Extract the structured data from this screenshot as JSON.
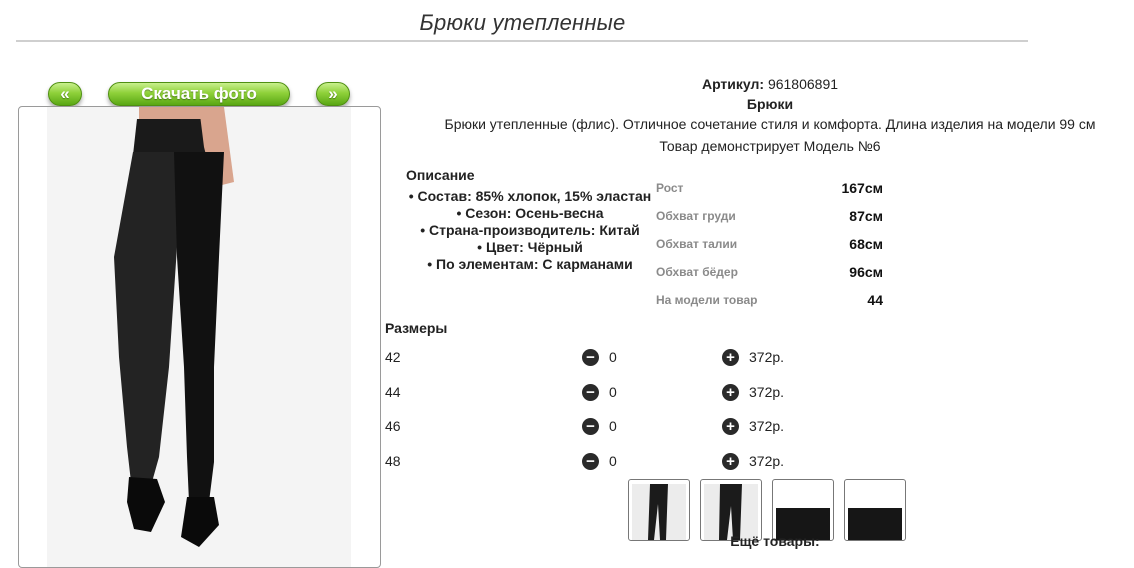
{
  "header": {
    "title": "Брюки утепленные"
  },
  "gallery": {
    "prev_label": "«",
    "download_label": "Скачать фото",
    "next_label": "»"
  },
  "product": {
    "article_label": "Артикул:",
    "article_value": "961806891",
    "type": "Брюки",
    "description": "Брюки утепленные (флис). Отличное сочетание стиля и комфорта. Длина изделия на модели 99 см",
    "model_note": "Товар демонстрирует Модель №6"
  },
  "description_block": {
    "title": "Описание",
    "items": [
      "• Состав: 85% хлопок, 15% эластан",
      "• Сезон: Осень-весна",
      "• Страна-производитель: Китай",
      "• Цвет: Чёрный",
      "• По элементам: С карманами"
    ]
  },
  "measurements": [
    {
      "label": "Рост",
      "value": "167см"
    },
    {
      "label": "Обхват груди",
      "value": "87см"
    },
    {
      "label": "Обхват талии",
      "value": "68см"
    },
    {
      "label": "Обхват бёдер",
      "value": "96см"
    },
    {
      "label": "На модели товар",
      "value": "44"
    }
  ],
  "sizes": {
    "title": "Размеры",
    "rows": [
      {
        "size": "42",
        "qty": "0",
        "price": "372р."
      },
      {
        "size": "44",
        "qty": "0",
        "price": "372р."
      },
      {
        "size": "46",
        "qty": "0",
        "price": "372р."
      },
      {
        "size": "48",
        "qty": "0",
        "price": "372р."
      }
    ]
  },
  "more_products_label": "Ещё товары:",
  "colors": {
    "button_green": "#8fd13a",
    "rule": "#cfcfcf",
    "measure_label": "#8a8a8a"
  }
}
